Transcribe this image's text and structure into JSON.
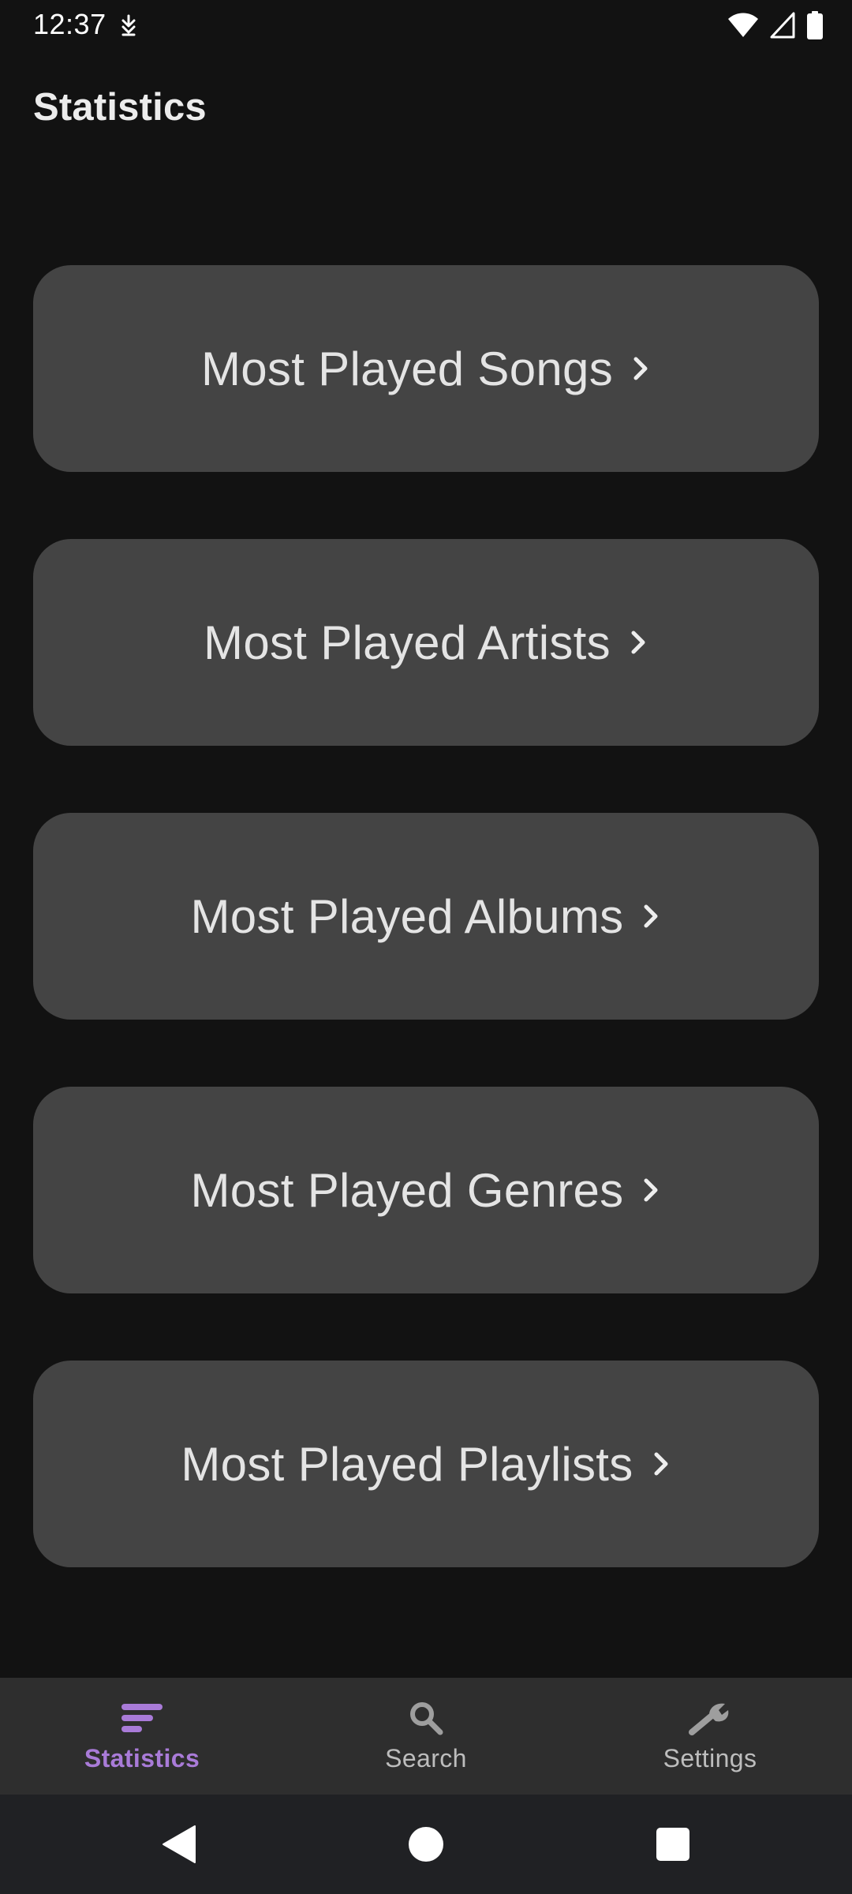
{
  "status_bar": {
    "time": "12:37",
    "left_icon": "data-saver-icon",
    "right_icons": [
      "wifi-icon",
      "cellular-signal-icon",
      "battery-icon"
    ]
  },
  "header": {
    "title": "Statistics"
  },
  "menu": {
    "items": [
      {
        "label": "Most Played Songs",
        "icon": "chevron-right-icon"
      },
      {
        "label": "Most Played Artists",
        "icon": "chevron-right-icon"
      },
      {
        "label": "Most Played Albums",
        "icon": "chevron-right-icon"
      },
      {
        "label": "Most Played Genres",
        "icon": "chevron-right-icon"
      },
      {
        "label": "Most Played Playlists",
        "icon": "chevron-right-icon"
      }
    ]
  },
  "bottom_nav": {
    "items": [
      {
        "label": "Statistics",
        "icon": "sort-lines-icon",
        "active": true
      },
      {
        "label": "Search",
        "icon": "search-icon",
        "active": false
      },
      {
        "label": "Settings",
        "icon": "wrench-icon",
        "active": false
      }
    ]
  },
  "system_nav": {
    "buttons": [
      "back-icon",
      "home-icon",
      "recents-icon"
    ]
  },
  "colors": {
    "background": "#121212",
    "card": "#444444",
    "nav_bar": "#2e2e2e",
    "system_nav": "#202124",
    "accent": "#a97bd8",
    "text": "#e4e4e4"
  }
}
